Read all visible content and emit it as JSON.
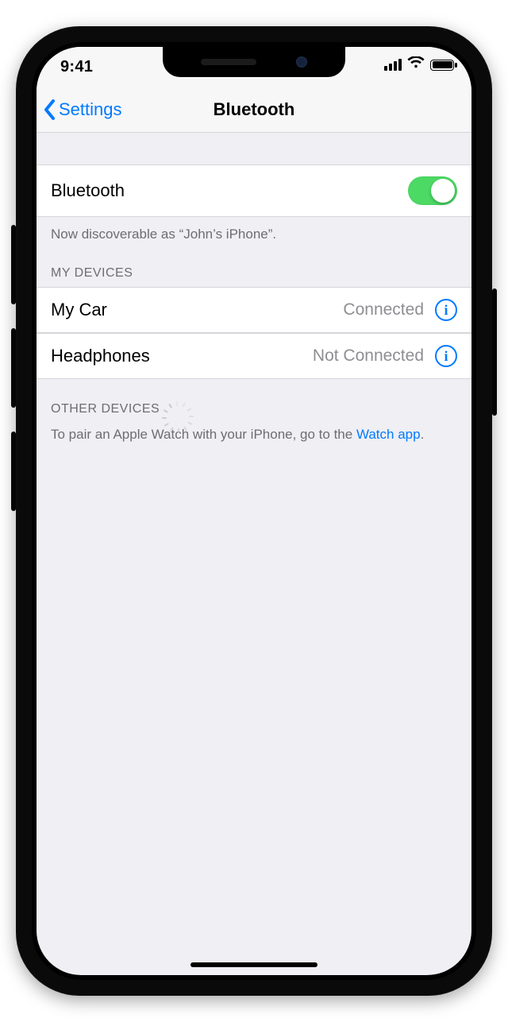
{
  "status_bar": {
    "time": "9:41"
  },
  "header": {
    "back_label": "Settings",
    "title": "Bluetooth"
  },
  "bluetooth": {
    "label": "Bluetooth",
    "enabled": true,
    "discoverable_text": "Now discoverable as “John’s iPhone”."
  },
  "sections": {
    "my_devices": "MY DEVICES",
    "other_devices": "OTHER DEVICES"
  },
  "my_devices": [
    {
      "name": "My Car",
      "status": "Connected"
    },
    {
      "name": "Headphones",
      "status": "Not Connected"
    }
  ],
  "other_devices": {
    "footer_text": "To pair an Apple Watch with your iPhone, go to the ",
    "link_text": "Watch app",
    "footer_suffix": "."
  },
  "colors": {
    "accent": "#007aff",
    "switch_on": "#4cd964"
  }
}
